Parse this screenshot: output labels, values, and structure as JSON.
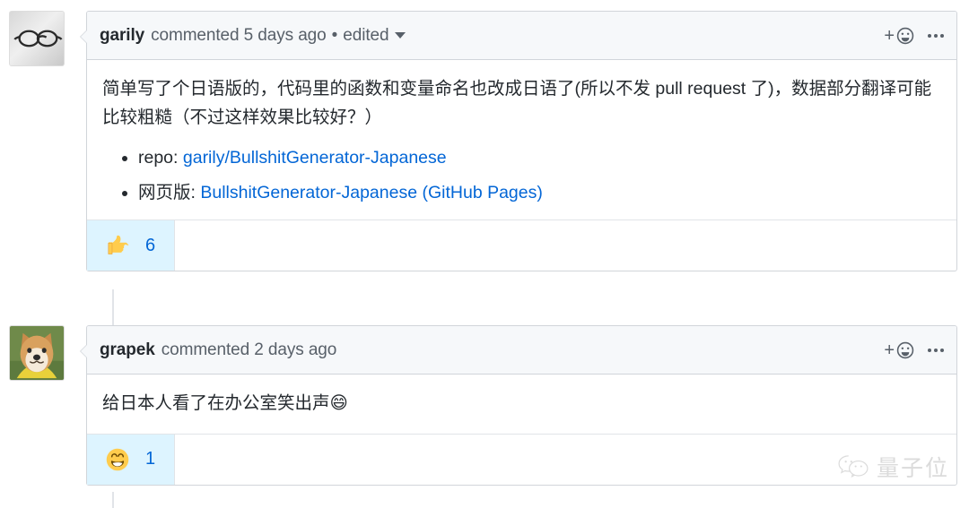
{
  "page": {
    "watermark_text": "量子位",
    "watermark_icon": "wechat-logo"
  },
  "comments": [
    {
      "id": "comment-garily",
      "author": "garily",
      "meta": "commented 5 days ago",
      "separator": "•",
      "edited_label": "edited",
      "has_edited_dropdown": true,
      "avatar_alt": "eyeglasses-avatar",
      "body": {
        "paragraph": "简单写了个日语版的，代码里的函数和变量命名也改成日语了(所以不发 pull request 了)，数据部分翻译可能比较粗糙（不过这样效果比较好？）",
        "list": [
          {
            "prefix": "repo: ",
            "link_text": "garily/BullshitGenerator-Japanese"
          },
          {
            "prefix": "网页版: ",
            "link_text": "BullshitGenerator-Japanese (GitHub Pages)"
          }
        ]
      },
      "reactions": [
        {
          "emoji": "thumbs-up",
          "count": "6",
          "selected": true
        }
      ],
      "actions": {
        "add_reaction_label": "+",
        "add_reaction_icon": "smiley-face-icon",
        "menu_icon": "kebab-menu-icon"
      }
    },
    {
      "id": "comment-grapek",
      "author": "grapek",
      "meta": "commented 2 days ago",
      "separator": "",
      "edited_label": "",
      "has_edited_dropdown": false,
      "avatar_alt": "shiba-inu-avatar",
      "body": {
        "paragraph": "给日本人看了在办公室笑出声😄",
        "list": []
      },
      "reactions": [
        {
          "emoji": "grinning-face",
          "count": "1",
          "selected": true
        }
      ],
      "actions": {
        "add_reaction_label": "+",
        "add_reaction_icon": "smiley-face-icon",
        "menu_icon": "kebab-menu-icon"
      }
    }
  ],
  "colors": {
    "link": "#0366d6",
    "border": "#d1d5da",
    "header_bg": "#f6f8fa",
    "text": "#24292e",
    "muted_text": "#586069",
    "reaction_selected_bg": "#ddf4ff"
  }
}
